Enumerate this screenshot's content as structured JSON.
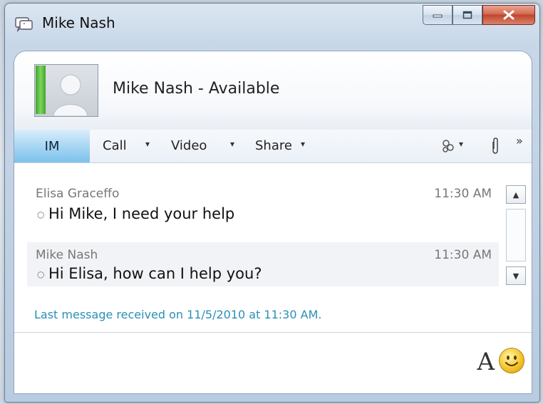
{
  "window": {
    "title": "Mike Nash"
  },
  "contact": {
    "name": "Mike Nash",
    "separator": " - ",
    "status": "Available"
  },
  "toolbar": {
    "tab_im": "IM",
    "call": "Call",
    "video": "Video",
    "share": "Share",
    "arrow": "▾",
    "more": "»"
  },
  "messages": [
    {
      "sender": "Elisa Graceffo",
      "time": "11:30 AM",
      "text": "Hi Mike, I need your help"
    },
    {
      "sender": "Mike Nash",
      "time": "11:30 AM",
      "text": "Hi Elisa, how can I help you?"
    }
  ],
  "status_line": "Last message received on 11/5/2010 at 11:30 AM.",
  "input": {
    "font_button": "A"
  },
  "colors": {
    "presence": "#3fa62c",
    "im_tab": "#7cc2ec",
    "status_text": "#2a8fb6",
    "close_button": "#c0452b"
  }
}
